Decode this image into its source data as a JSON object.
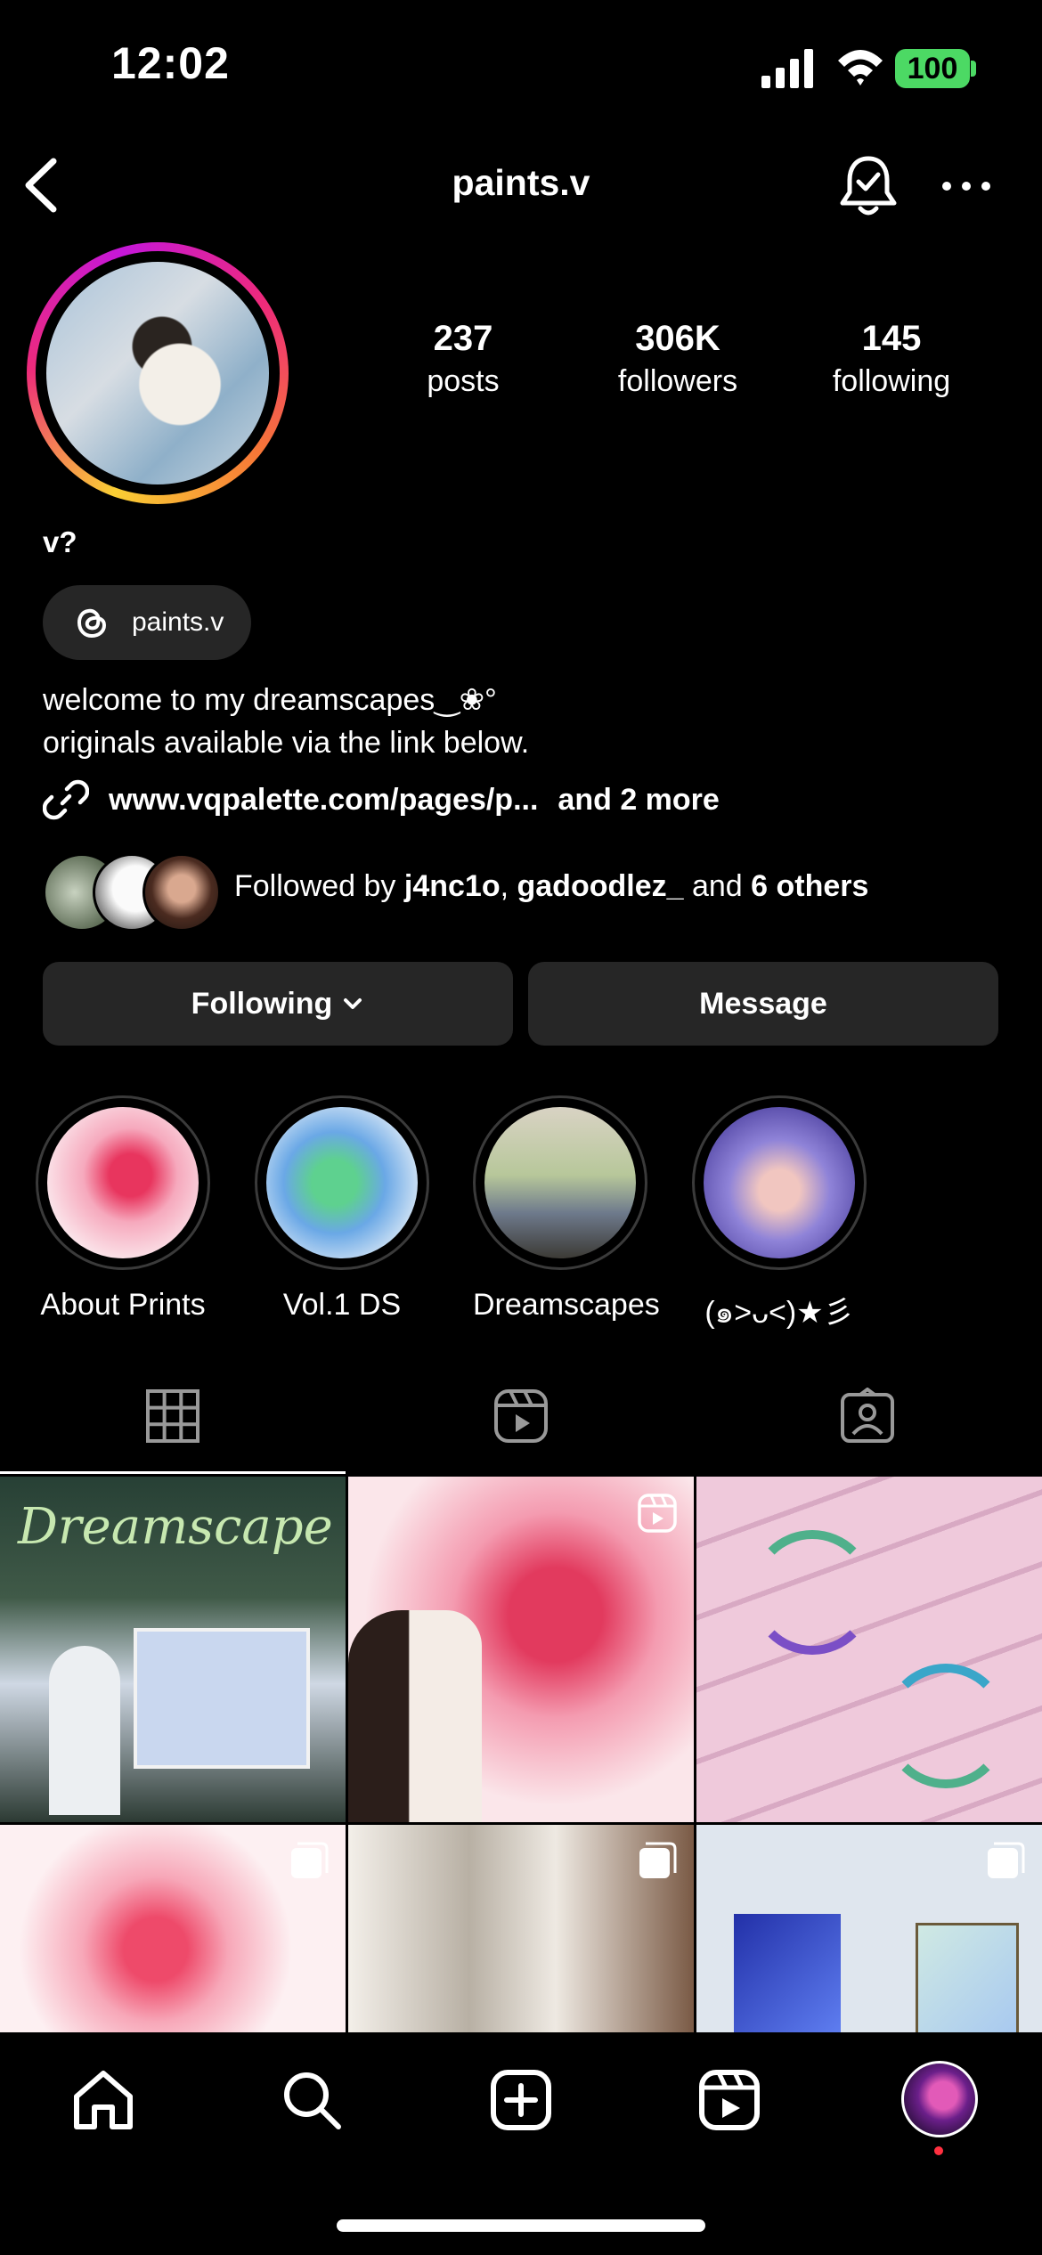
{
  "status_bar": {
    "time": "12:02",
    "battery": "100"
  },
  "header": {
    "username": "paints.v"
  },
  "profile": {
    "stats": [
      {
        "value": "237",
        "label": "posts"
      },
      {
        "value": "306K",
        "label": "followers"
      },
      {
        "value": "145",
        "label": "following"
      }
    ],
    "display_name": "v?",
    "threads_label": "paints.v",
    "bio_line1": "welcome to my dreamscapes‿❀°",
    "bio_line2": "originals available via the link below.",
    "link_text": "www.vqpalette.com/pages/p...",
    "link_more": "and 2 more",
    "followed": {
      "prefix": "Followed by ",
      "user1": "j4nc1o",
      "sep": ", ",
      "user2": "gadoodlez_",
      "mid": " and ",
      "others": "6 others"
    },
    "following_button": "Following",
    "message_button": "Message"
  },
  "highlights": [
    {
      "label": "About Prints",
      "color": "#f07a9a"
    },
    {
      "label": "Vol.1 DS",
      "color": "#6fc9a8"
    },
    {
      "label": "Dreamscapes",
      "color": "#c9b48a"
    },
    {
      "label": "(๑˃ᴗ˂)★彡",
      "color": "#8d86d6"
    }
  ],
  "tabs": [
    "grid-icon",
    "reels-icon",
    "tagged-icon"
  ],
  "grid_posts": [
    {
      "kind": "image",
      "badge": "",
      "colors": [
        "#2f4a3a",
        "#9db7c9"
      ],
      "caption": "Dreamscape"
    },
    {
      "kind": "reel",
      "badge": "reel-icon",
      "colors": [
        "#f4d9de",
        "#e55a7a"
      ],
      "caption": ""
    },
    {
      "kind": "image",
      "badge": "",
      "colors": [
        "#e7c3d8",
        "#4fb08b"
      ],
      "caption": ""
    },
    {
      "kind": "carousel",
      "badge": "carousel-icon",
      "colors": [
        "#fbeaee",
        "#ee4a6a"
      ],
      "caption": ""
    },
    {
      "kind": "carousel",
      "badge": "carousel-icon",
      "colors": [
        "#f0ede8",
        "#6a4a3a"
      ],
      "caption": ""
    },
    {
      "kind": "carousel",
      "badge": "carousel-icon",
      "colors": [
        "#dfe6ee",
        "#3452b8"
      ],
      "caption": ""
    }
  ],
  "nav": [
    "home-icon",
    "search-icon",
    "create-icon",
    "reels-icon",
    "profile-avatar"
  ]
}
